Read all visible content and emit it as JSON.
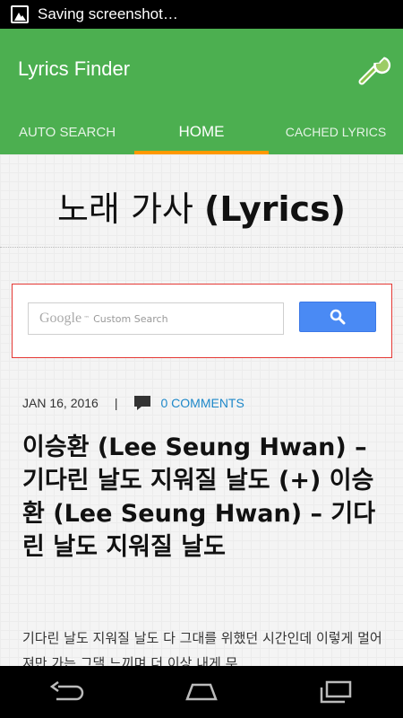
{
  "status_bar": {
    "text": "Saving screenshot…",
    "icon": "image-icon"
  },
  "app_bar": {
    "title": "Lyrics Finder",
    "settings_icon": "wrench-icon",
    "color": "#4caf50",
    "accent": "#ff9800"
  },
  "tabs": [
    {
      "label": "AUTO SEARCH",
      "active": false
    },
    {
      "label": "HOME",
      "active": true
    },
    {
      "label": "CACHED LYRICS",
      "active": false
    }
  ],
  "page": {
    "site_title_korean": "노래 가사 ",
    "site_title_latin": "(Lyrics)",
    "search": {
      "google_label": "Google",
      "tm": "™",
      "placeholder": "Custom Search",
      "button_icon": "search-icon"
    },
    "post": {
      "date": "JAN 16, 2016",
      "separator": "|",
      "comments": "0 COMMENTS",
      "title": "이승환 (Lee Seung Hwan) – 기다린 날도 지워질 날도 (+) 이승환 (Lee Seung Hwan) – 기다린 날도 지워질 날도",
      "body": "기다린 날도 지워질 날도 다 그대를 위했던 시간인데 이렇게 멀어져만 가는 그댈 느끼며 더 이상 내게 무"
    }
  },
  "nav_bar": {
    "back_icon": "back-icon",
    "home_icon": "home-icon",
    "recents_icon": "recents-icon"
  }
}
